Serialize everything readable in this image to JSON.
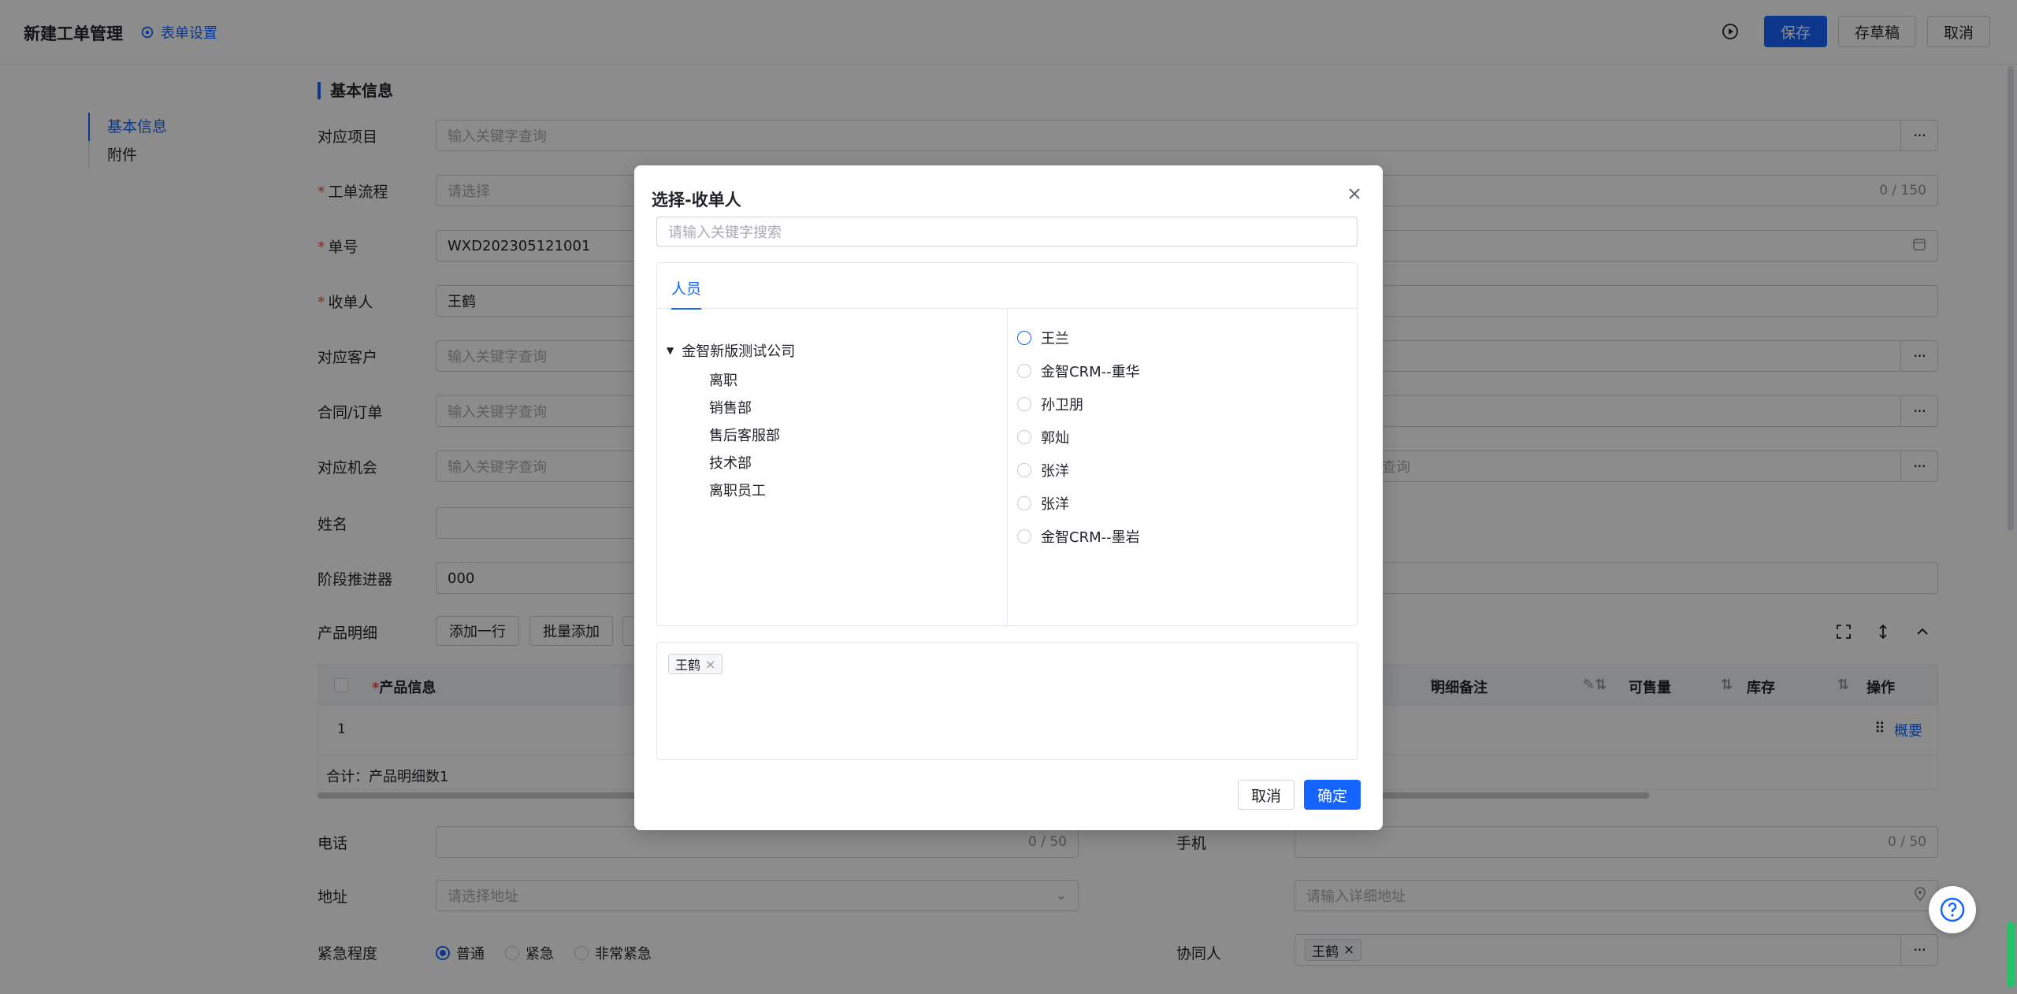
{
  "header": {
    "title": "新建工单管理",
    "settings_label": "表单设置",
    "save_label": "保存",
    "draft_label": "存草稿",
    "cancel_label": "取消"
  },
  "nav": {
    "items": [
      {
        "label": "基本信息",
        "active": true
      },
      {
        "label": "附件",
        "active": false
      }
    ]
  },
  "form": {
    "section_title": "基本信息",
    "fields": {
      "project": {
        "label": "对应项目",
        "placeholder": "输入关键字查询"
      },
      "flow": {
        "label": "工单流程",
        "placeholder": "请选择",
        "counter": "0 / 150"
      },
      "order_no": {
        "label": "单号",
        "value": "WXD202305121001"
      },
      "receiver": {
        "label": "收单人",
        "value": "王鹤"
      },
      "customer": {
        "label": "对应客户",
        "placeholder": "输入关键字查询"
      },
      "contract": {
        "label": "合同/订单",
        "placeholder": "输入关键字查询"
      },
      "opportunity": {
        "label": "对应机会",
        "placeholder": "输入关键字查询",
        "right_placeholder_fragment": "查询"
      },
      "name": {
        "label": "姓名"
      },
      "stage": {
        "label": "阶段推进器",
        "value": "000"
      },
      "product_detail": {
        "label": "产品明细",
        "add_row": "添加一行",
        "batch_add": "批量添加"
      },
      "phone": {
        "label": "电话",
        "counter": "0 / 50"
      },
      "mobile": {
        "label": "手机",
        "counter": "0 / 50"
      },
      "address": {
        "label": "地址",
        "placeholder": "请选择地址",
        "detail_placeholder": "请输入详细地址"
      },
      "urgency": {
        "label": "紧急程度",
        "options": [
          "普通",
          "紧急",
          "非常紧急"
        ],
        "selected": "普通"
      },
      "collaborator": {
        "label": "协同人",
        "tag": "王鹤"
      }
    },
    "table": {
      "columns": {
        "product": "产品信息",
        "detail_note": "明细备注",
        "available": "可售量",
        "stock": "库存",
        "action": "操作"
      },
      "row_no": "1",
      "row_action": "概要",
      "summary": "合计：产品明细数1"
    }
  },
  "modal": {
    "title": "选择-收单人",
    "search_placeholder": "请输入关键字搜索",
    "tab": "人员",
    "tree": {
      "root": "金智新版测试公司",
      "children": [
        "离职",
        "销售部",
        "售后客服部",
        "技术部",
        "离职员工"
      ]
    },
    "people": [
      "王兰",
      "金智CRM--重华",
      "孙卫朋",
      "郭灿",
      "张洋",
      "张洋",
      "金智CRM--墨岩"
    ],
    "selected_tag": "王鹤",
    "cancel_label": "取消",
    "confirm_label": "确定"
  },
  "colors": {
    "primary": "#1664ff",
    "required": "#f54a45",
    "mask": "rgba(0,0,0,0.45)"
  },
  "icons": [
    "settings-icon",
    "play-circle-icon",
    "close-icon",
    "calendar-icon",
    "location-icon",
    "help-icon",
    "caret-down-icon",
    "more-icon",
    "fullscreen-icon",
    "expand-icon",
    "collapse-icon",
    "drag-icon",
    "edit-icon",
    "sort-icon",
    "chevron-down-icon"
  ]
}
